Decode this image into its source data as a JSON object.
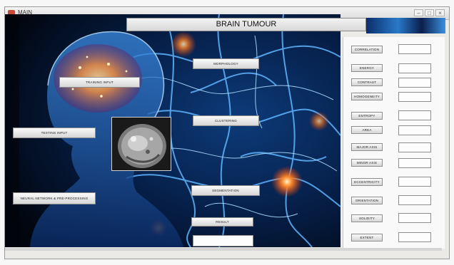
{
  "window": {
    "title": "MAIN"
  },
  "header": {
    "title": "BRAIN TUMOUR"
  },
  "left_buttons": {
    "training_input": "TRAINING INPUT",
    "testing_input": "TESTING INPUT",
    "neural_network": "NEURAL NETWORK & PRE-PROCESSING"
  },
  "center_buttons": {
    "morphology": "MORPHOLOGY",
    "clustering": "CLUSTERING",
    "segmentation": "SEGMENTATION",
    "result": "RESULT"
  },
  "result_field": {
    "value": ""
  },
  "features": [
    {
      "label": "CORRELATION",
      "value": ""
    },
    {
      "label": "ENERGY",
      "value": ""
    },
    {
      "label": "CONTRAST",
      "value": ""
    },
    {
      "label": "HOMOGENEITY",
      "value": ""
    },
    {
      "label": "ENTROPY",
      "value": ""
    },
    {
      "label": "AREA",
      "value": ""
    },
    {
      "label": "MAJOR AXIS",
      "value": ""
    },
    {
      "label": "MINOR AXIS",
      "value": ""
    },
    {
      "label": "ECCENTRICITY",
      "value": ""
    },
    {
      "label": "ORIENTATION",
      "value": ""
    },
    {
      "label": "SOLIDITY",
      "value": ""
    },
    {
      "label": "EXTENT",
      "value": ""
    }
  ],
  "colors": {
    "background_dark": "#02060f",
    "neuron_blue": "#3aa0ff",
    "glow_orange": "#ff9a3c"
  }
}
